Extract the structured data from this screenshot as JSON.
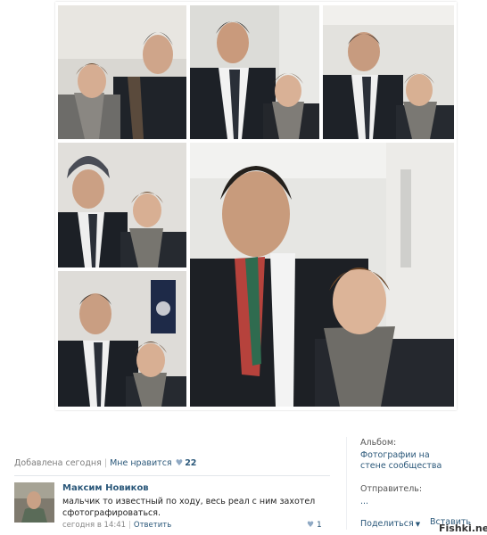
{
  "post": {
    "added_label": "Добавлена сегодня",
    "separator": "|",
    "like_label": "Мне нравится",
    "heart_icon": "heart-icon",
    "like_count": "22"
  },
  "comment": {
    "author": "Максим Новиков",
    "text": "мальчик то известный по ходу, весь реал с ним захотел сфотографироваться.",
    "time": "сегодня в 14:41",
    "separator": "|",
    "reply_label": "Ответить",
    "like_count": "1"
  },
  "sidebar": {
    "album_label": "Альбом:",
    "album_name": "Фотографии на стене сообщества",
    "sender_label": "Отправитель:",
    "sender_value": "...",
    "share_label": "Поделиться",
    "share_caret": "▼",
    "share_overlap": "Вставить"
  },
  "watermark": "Fishki.net",
  "colors": {
    "link": "#2b587a",
    "muted": "#7d7d7d"
  }
}
